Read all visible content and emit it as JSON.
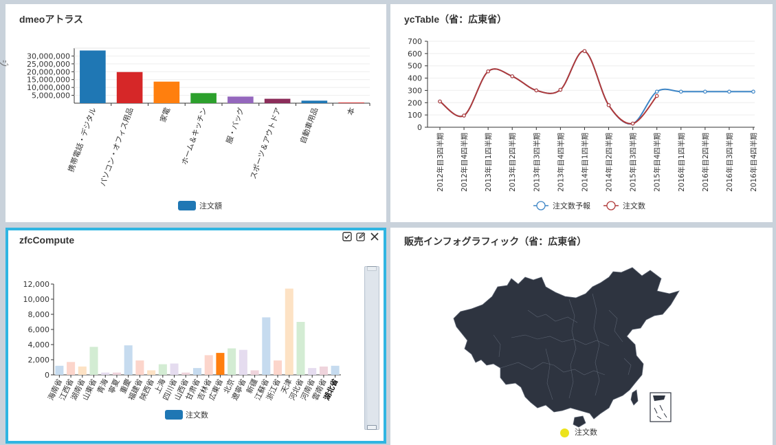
{
  "panels": {
    "p1": {
      "title": "dmeoアトラス",
      "side_glyph": "ジ",
      "legend": "注文額",
      "color": "#1f77b4"
    },
    "p2": {
      "title": "ycTable（省：広東省）",
      "legend": [
        "注文数予報",
        "注文数"
      ],
      "colors": [
        "#3d85c6",
        "#b03a3a"
      ]
    },
    "p3": {
      "title": "zfcCompute",
      "legend": "注文数",
      "color": "#1f77b4",
      "highlight_color": "#ff7f0e"
    },
    "p4": {
      "title": "販売インフォグラフィック（省：広東省）",
      "legend": "注文数",
      "legend_color": "#ece31c",
      "map_color": "#2e3440"
    }
  },
  "chart_data": [
    {
      "type": "bar",
      "title": "dmeoアトラス",
      "categories": [
        "携帯電話・デジタル",
        "パソコン・オフィス用品",
        "家電",
        "ホーム＆キッチン",
        "服・バッグ",
        "スポーツ＆アウトドア",
        "自動車用品",
        "本"
      ],
      "series": [
        {
          "name": "注文額",
          "values": [
            33500000,
            19800000,
            13700000,
            6400000,
            4200000,
            2800000,
            1600000,
            400000
          ]
        }
      ],
      "colors": [
        "#1f77b4",
        "#d62728",
        "#ff7f0e",
        "#2ca02c",
        "#9467bd",
        "#8c2d5a",
        "#1f77b4",
        "#d62728"
      ],
      "yticks": [
        "5,000,000",
        "10,000,000",
        "15,000,000",
        "20,000,000",
        "25,000,000",
        "30,000,000"
      ],
      "ylim": [
        0,
        35000000
      ],
      "legend": "bottom"
    },
    {
      "type": "line",
      "title": "ycTable（省：広東省）",
      "categories": [
        "2012年目3四半期",
        "2012年目4四半期",
        "2013年目1四半期",
        "2013年目2四半期",
        "2013年目3四半期",
        "2013年目4四半期",
        "2014年目1四半期",
        "2014年目2四半期",
        "2015年目3四半期",
        "2015年目4四半期",
        "2016年目1四半期",
        "2016年目2四半期",
        "2016年目3四半期",
        "2016年目4四半期"
      ],
      "series": [
        {
          "name": "注文数予報",
          "values": [
            210,
            95,
            455,
            415,
            300,
            305,
            620,
            180,
            30,
            290,
            290,
            290,
            290,
            290
          ]
        },
        {
          "name": "注文数",
          "values": [
            210,
            95,
            455,
            415,
            300,
            305,
            620,
            180,
            30,
            255,
            null,
            null,
            null,
            null
          ]
        }
      ],
      "yticks": [
        0,
        100,
        200,
        300,
        400,
        500,
        600,
        700
      ],
      "ylim": [
        0,
        700
      ],
      "legend": "bottom"
    },
    {
      "type": "bar",
      "title": "zfcCompute",
      "categories": [
        "海南省",
        "江西省",
        "湖南省",
        "山東省",
        "青海",
        "寧夏",
        "重慶",
        "福建省",
        "陝西省",
        "上海",
        "四川省",
        "山西省",
        "甘肃省",
        "吉林省",
        "広東省",
        "北京",
        "遼寧省",
        "新疆",
        "江蘇省",
        "浙江省",
        "天津",
        "河北省",
        "河南省",
        "雲南省",
        "湖北省"
      ],
      "series": [
        {
          "name": "注文数",
          "values": [
            1200,
            1700,
            1100,
            3700,
            300,
            300,
            3900,
            1900,
            600,
            1400,
            1500,
            300,
            900,
            2600,
            2900,
            3500,
            3300,
            600,
            7600,
            1900,
            11400,
            7000,
            900,
            1100,
            1200
          ]
        }
      ],
      "colors": [
        "#c6dbef",
        "#fcd5cb",
        "#fde2c4",
        "#d3ecd3",
        "#e5dcef",
        "#efd4dc",
        "#c6dbef",
        "#fcd5cb",
        "#fde2c4",
        "#d3ecd3",
        "#e5dcef",
        "#efd4dc",
        "#c6dbef",
        "#fcd5cb",
        "#ff7f0e",
        "#d3ecd3",
        "#e5dcef",
        "#efd4dc",
        "#c6dbef",
        "#fcd5cb",
        "#fde2c4",
        "#d3ecd3",
        "#e5dcef",
        "#efd4dc",
        "#c6dbef"
      ],
      "highlight": "広東省",
      "yticks": [
        "0",
        "2,000",
        "4,000",
        "6,000",
        "8,000",
        "10,000",
        "12,000"
      ],
      "ylim": [
        0,
        12000
      ],
      "legend": "bottom"
    }
  ]
}
